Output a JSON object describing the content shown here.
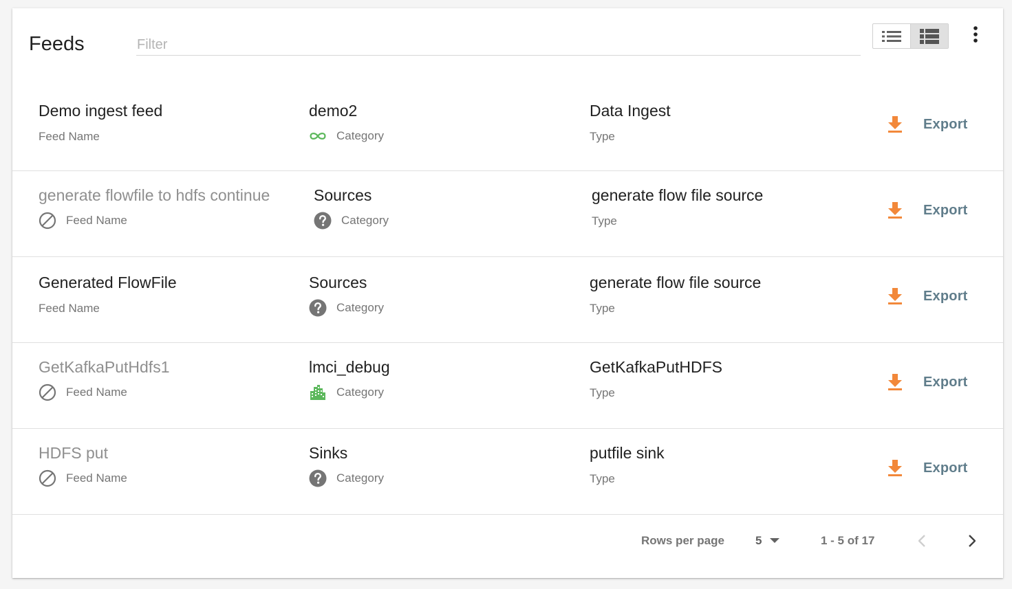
{
  "header": {
    "title": "Feeds",
    "filter_placeholder": "Filter",
    "filter_value": ""
  },
  "colors": {
    "accent_orange": "#f2883a",
    "export_text": "#607d8b",
    "category_green": "#5cb85c"
  },
  "feeds": [
    {
      "name": "Demo ingest feed",
      "name_label": "Feed Name",
      "disabled": false,
      "category": "demo2",
      "category_label": "Category",
      "category_icon": "infinity-icon",
      "type": "Data Ingest",
      "type_label": "Type",
      "export_label": "Export"
    },
    {
      "name": "generate flowfile to hdfs continue",
      "name_label": "Feed Name",
      "disabled": true,
      "category": "Sources",
      "category_label": "Category",
      "category_icon": "help-circle-icon",
      "type": "generate flow file source",
      "type_label": "Type",
      "export_label": "Export"
    },
    {
      "name": "Generated FlowFile",
      "name_label": "Feed Name",
      "disabled": false,
      "category": "Sources",
      "category_label": "Category",
      "category_icon": "help-circle-icon",
      "type": "generate flow file source",
      "type_label": "Type",
      "export_label": "Export"
    },
    {
      "name": "GetKafkaPutHdfs1",
      "name_label": "Feed Name",
      "disabled": true,
      "category": "lmci_debug",
      "category_label": "Category",
      "category_icon": "building-icon",
      "type": "GetKafkaPutHDFS",
      "type_label": "Type",
      "export_label": "Export"
    },
    {
      "name": "HDFS put",
      "name_label": "Feed Name",
      "disabled": true,
      "category": "Sinks",
      "category_label": "Category",
      "category_icon": "help-circle-icon",
      "type": "putfile sink",
      "type_label": "Type",
      "export_label": "Export"
    }
  ],
  "pagination": {
    "rows_per_page_label": "Rows per page",
    "rows_per_page_value": "5",
    "range_label": "1 - 5 of 17"
  }
}
